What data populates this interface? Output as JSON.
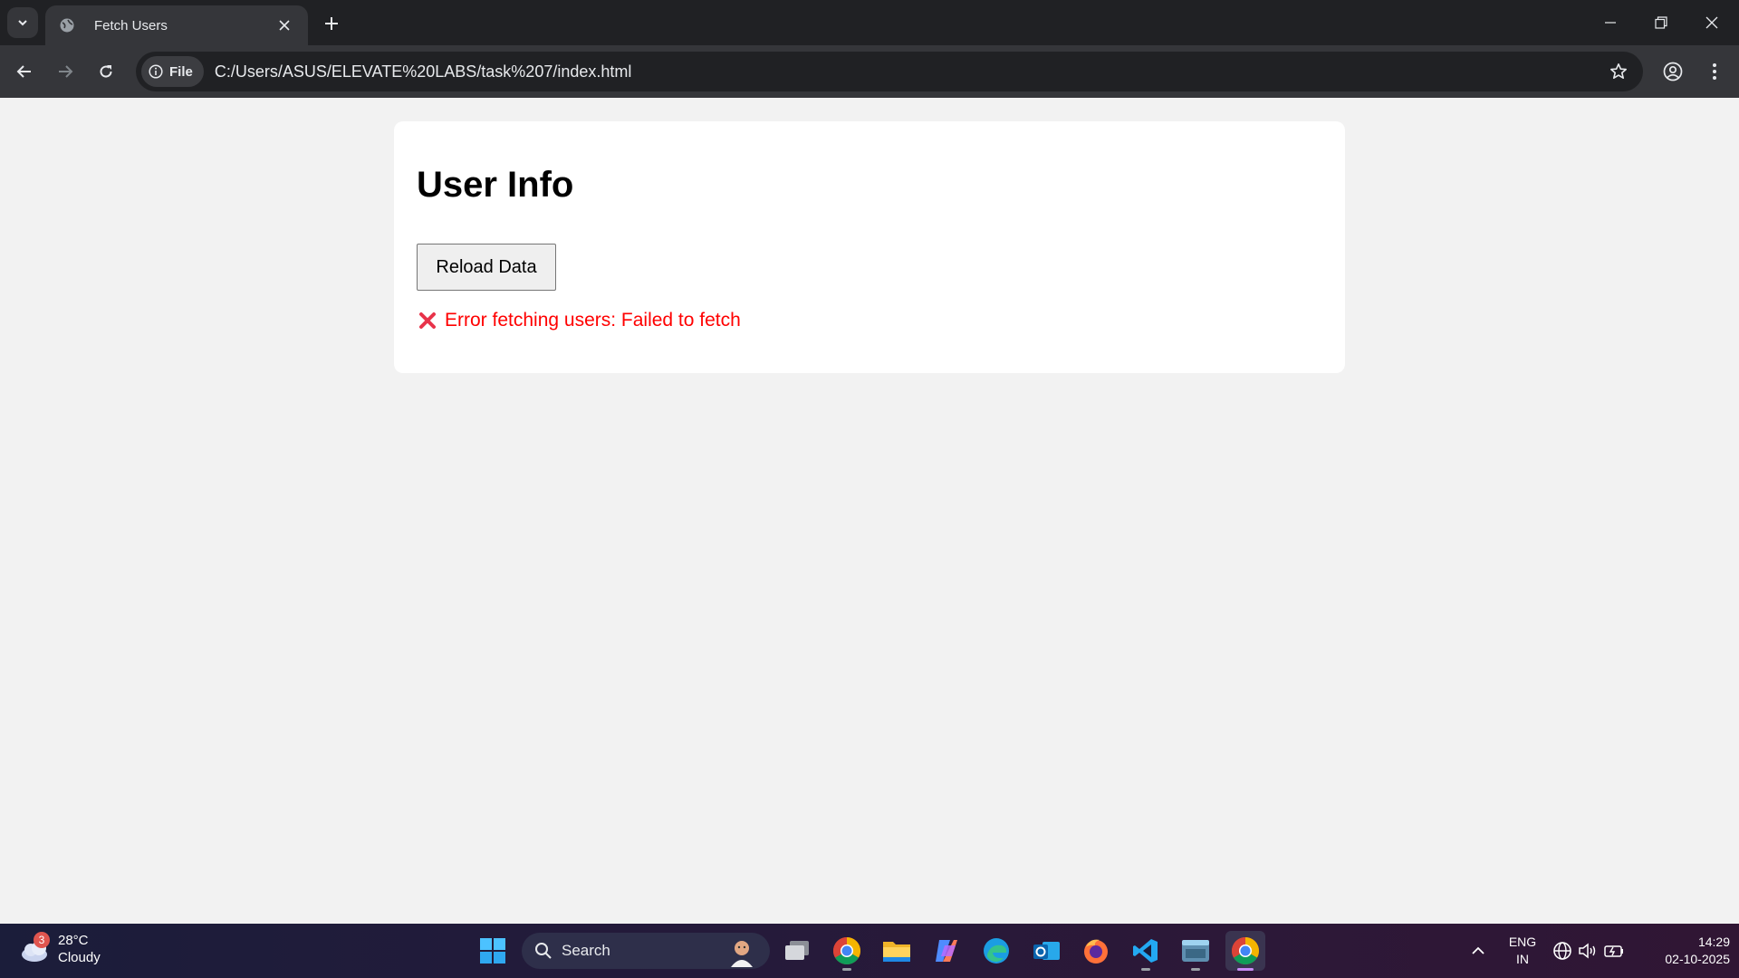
{
  "browser": {
    "tab_title": "Fetch Users",
    "site_chip_label": "File",
    "url": "C:/Users/ASUS/ELEVATE%20LABS/task%207/index.html"
  },
  "page": {
    "title": "User Info",
    "reload_label": "Reload Data",
    "error_message": "Error fetching users: Failed to fetch",
    "error_color": "#ff0000"
  },
  "taskbar": {
    "weather_temp": "28°C",
    "weather_desc": "Cloudy",
    "weather_badge": "3",
    "search_label": "Search",
    "lang_line1": "ENG",
    "lang_line2": "IN",
    "time": "14:29",
    "date": "02-10-2025"
  }
}
